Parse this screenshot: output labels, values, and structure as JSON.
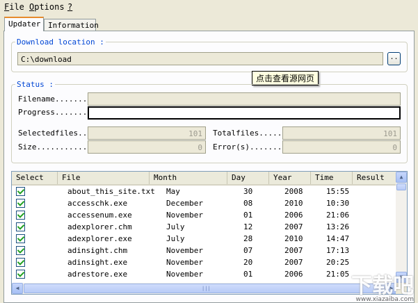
{
  "menu": [
    {
      "key": "F",
      "rest": "ile"
    },
    {
      "key": "O",
      "rest": "ptions"
    },
    {
      "key": "?",
      "rest": ""
    }
  ],
  "tabs": {
    "updater": "Updater",
    "information": "Information"
  },
  "download": {
    "title": "Download location :",
    "path": "C:\\download",
    "browse_label": ".."
  },
  "tooltip": "点击查看源网页",
  "status": {
    "title": "Status :",
    "filename_label": "Filename........",
    "filename_value": "",
    "progress_label": "Progress........",
    "progress_fraction": 0,
    "selectedfiles_label": "Selectedfiles...",
    "selectedfiles_value": "101",
    "size_label": "Size............",
    "size_value": "0",
    "totalfiles_label": "Totalfiles......",
    "totalfiles_value": "101",
    "errors_label": "Error(s)........",
    "errors_value": "0"
  },
  "table": {
    "columns": [
      "Select",
      "File",
      "Month",
      "Day",
      "Year",
      "Time",
      "Result"
    ],
    "rows": [
      {
        "checked": true,
        "file": "about_this_site.txt",
        "month": "May",
        "day": "30",
        "year": "2008",
        "time": "15:55",
        "result": ""
      },
      {
        "checked": true,
        "file": "accesschk.exe",
        "month": "December",
        "day": "08",
        "year": "2010",
        "time": "10:30",
        "result": ""
      },
      {
        "checked": true,
        "file": "accessenum.exe",
        "month": "November",
        "day": "01",
        "year": "2006",
        "time": "21:06",
        "result": ""
      },
      {
        "checked": true,
        "file": "adexplorer.chm",
        "month": "July",
        "day": "12",
        "year": "2007",
        "time": "13:26",
        "result": ""
      },
      {
        "checked": true,
        "file": "adexplorer.exe",
        "month": "July",
        "day": "28",
        "year": "2010",
        "time": "14:47",
        "result": ""
      },
      {
        "checked": true,
        "file": "adinsight.chm",
        "month": "November",
        "day": "07",
        "year": "2007",
        "time": "17:13",
        "result": ""
      },
      {
        "checked": true,
        "file": "adinsight.exe",
        "month": "November",
        "day": "20",
        "year": "2007",
        "time": "20:25",
        "result": ""
      },
      {
        "checked": true,
        "file": "adrestore.exe",
        "month": "November",
        "day": "01",
        "year": "2006",
        "time": "21:05",
        "result": ""
      }
    ]
  },
  "watermark": {
    "text": "下载吧",
    "url": "www.xiazaiba.com"
  },
  "icons": {
    "browse": "ellipsis-icon",
    "check": "checkmark-icon",
    "scroll_up": "arrow-up-icon",
    "scroll_down": "arrow-down-icon",
    "scroll_left": "arrow-left-icon",
    "scroll_right": "arrow-right-icon"
  }
}
